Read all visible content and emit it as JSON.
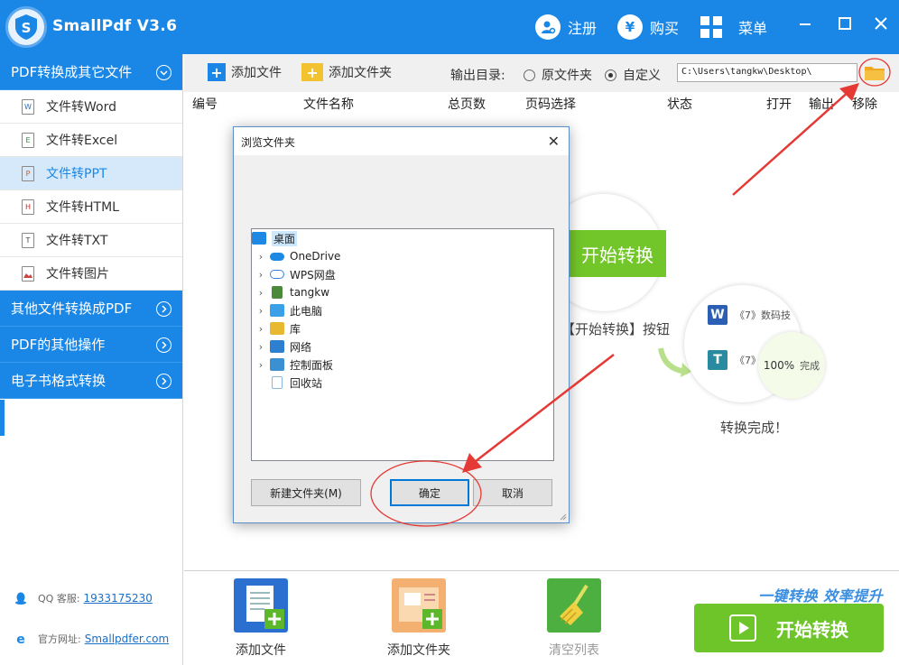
{
  "app": {
    "title": "SmallPdf V3.6",
    "header_actions": {
      "register": "注册",
      "buy": "购买",
      "menu": "菜单"
    },
    "buy_icon_glyph": "¥"
  },
  "sidebar": {
    "categories": [
      {
        "label": "PDF转换成其它文件",
        "expanded": true
      },
      {
        "label": "其他文件转换成PDF",
        "expanded": false
      },
      {
        "label": "PDF的其他操作",
        "expanded": false
      },
      {
        "label": "电子书格式转换",
        "expanded": false
      }
    ],
    "items": [
      {
        "label": "文件转Word",
        "icon_letter": "W",
        "active": false
      },
      {
        "label": "文件转Excel",
        "icon_letter": "E",
        "active": false
      },
      {
        "label": "文件转PPT",
        "icon_letter": "P",
        "active": true
      },
      {
        "label": "文件转HTML",
        "icon_letter": "H",
        "active": false
      },
      {
        "label": "文件转TXT",
        "icon_letter": "T",
        "active": false
      },
      {
        "label": "文件转图片",
        "icon_letter": "",
        "active": false
      }
    ],
    "contact": {
      "qq_label": "QQ 客服:",
      "qq_value": "1933175230",
      "site_label": "官方网址:",
      "site_value": "Smallpdfer.com"
    }
  },
  "toolbar": {
    "add_file": "添加文件",
    "add_folder": "添加文件夹",
    "output_label": "输出目录:",
    "radio_original": "原文件夹",
    "radio_custom": "自定义",
    "selected_output": "custom",
    "output_path": "C:\\Users\\tangkw\\Desktop\\"
  },
  "table": {
    "columns": [
      "编号",
      "文件名称",
      "总页数",
      "页码选择",
      "状态",
      "打开",
      "输出",
      "移除"
    ]
  },
  "illustration": {
    "start_label": "开始转换",
    "hint_text": "【开始转换】按钮",
    "row1_text": "《7》数码技",
    "row2_text": "《7》",
    "progress_value": "100%",
    "progress_label": "完成",
    "done_text": "转换完成！"
  },
  "bottombar": {
    "add_file": "添加文件",
    "add_folder": "添加文件夹",
    "clear_list": "清空列表",
    "slogan": "一键转换  效率提升",
    "start_button": "开始转换"
  },
  "dialog": {
    "title": "浏览文件夹",
    "close_glyph": "✕",
    "tree": [
      {
        "label": "桌面",
        "expandable": false,
        "selected": true,
        "icon": "desktop-icon",
        "color": "#1e88e5"
      },
      {
        "label": "OneDrive",
        "expandable": true,
        "selected": false,
        "icon": "onedrive-icon",
        "color": "#1e88e5"
      },
      {
        "label": "WPS网盘",
        "expandable": true,
        "selected": false,
        "icon": "wps-cloud-icon",
        "color": "#3c7fd9"
      },
      {
        "label": "tangkw",
        "expandable": true,
        "selected": false,
        "icon": "user-icon",
        "color": "#4a8a3a"
      },
      {
        "label": "此电脑",
        "expandable": true,
        "selected": false,
        "icon": "computer-icon",
        "color": "#3aa0e8"
      },
      {
        "label": "库",
        "expandable": true,
        "selected": false,
        "icon": "library-icon",
        "color": "#e8b830"
      },
      {
        "label": "网络",
        "expandable": true,
        "selected": false,
        "icon": "network-icon",
        "color": "#2e7fd0"
      },
      {
        "label": "控制面板",
        "expandable": true,
        "selected": false,
        "icon": "control-panel-icon",
        "color": "#3a90d0"
      },
      {
        "label": "回收站",
        "expandable": false,
        "selected": false,
        "icon": "recycle-bin-icon",
        "color": "#8ab8e0"
      }
    ],
    "new_folder": "新建文件夹(M)",
    "ok": "确定",
    "cancel": "取消"
  },
  "colors": {
    "brand_blue": "#1a87e6",
    "accent_green": "#6dc52a",
    "annotation_red": "#e53935"
  }
}
